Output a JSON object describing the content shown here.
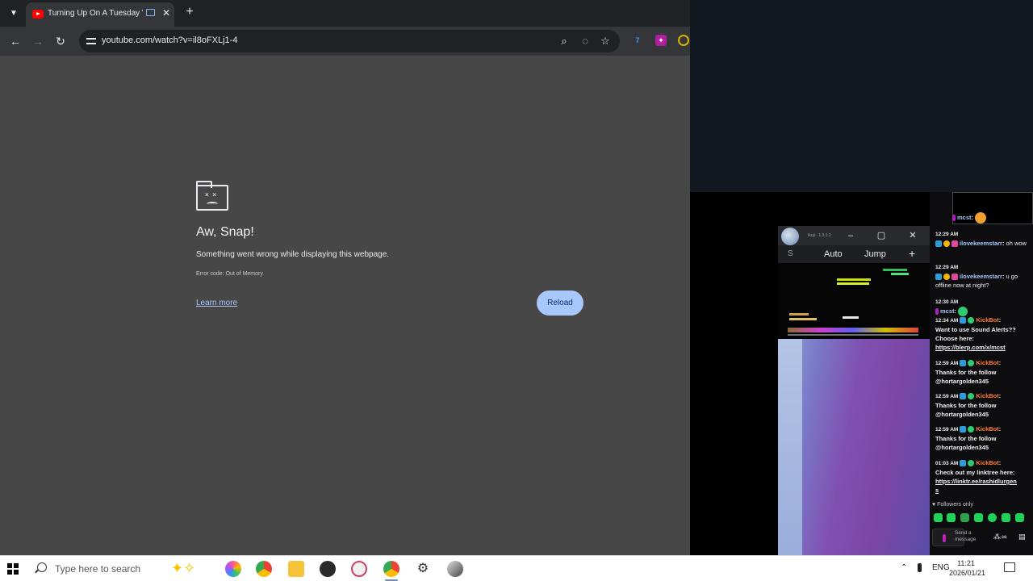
{
  "browser": {
    "tab": {
      "title": "Turning Up On A Tuesday V",
      "close": "✕"
    },
    "new_tab": "+",
    "url": "youtube.com/watch?v=il8oFXLj1-4"
  },
  "error_page": {
    "title": "Aw, Snap!",
    "description": "Something went wrong while displaying this webpage.",
    "error_code": "Error code: Out of Memory",
    "learn_more": "Learn more",
    "reload": "Reload"
  },
  "mini_player": {
    "title": "Ikuji · 1.3.1.2",
    "side_label": "S",
    "auto": "Auto",
    "jump": "Jump",
    "plus": "+"
  },
  "chat": {
    "top_user": "mcst",
    "messages": [
      {
        "time": "12:29 AM",
        "user": "ilovekeemstarr",
        "text": "oh wow",
        "user_color": "blue"
      },
      {
        "time": "12:29 AM",
        "user": "ilovekeemstarr",
        "text": "u go offline now at night?",
        "user_color": "blue"
      },
      {
        "time": "12:30 AM",
        "user": "mcst",
        "text": "",
        "user_color": "blue"
      },
      {
        "time": "12:34 AM",
        "user": "KickBot",
        "text": "Want to use Sound Alerts?? Choose here:",
        "link": "https://blerp.com/x/mcst",
        "user_color": "orange"
      },
      {
        "time": "12:59 AM",
        "user": "KickBot",
        "text": "Thanks for the follow @hortargolden345",
        "user_color": "orange"
      },
      {
        "time": "12:59 AM",
        "user": "KickBot",
        "text": "Thanks for the follow @hortargolden345",
        "user_color": "orange"
      },
      {
        "time": "12:59 AM",
        "user": "KickBot",
        "text": "Thanks for the follow @hortargolden345",
        "user_color": "orange"
      },
      {
        "time": "01:03 AM",
        "user": "KickBot",
        "text": "Check out my linktree here:",
        "link": "https://linktr.ee/rashidlurgen",
        "link_tail": "s",
        "user_color": "orange"
      }
    ],
    "followers_only": "Followers only",
    "send_placeholder": "Send a message"
  },
  "taskbar": {
    "search_placeholder": "Type here to search",
    "lang": "ENG",
    "time": "11:21",
    "date": "2026/01/21"
  },
  "colors": {
    "page_bg": "#474747",
    "reload_bg": "#a8c7fa",
    "kickbot": "#ff7a2e",
    "chat_user": "#a8c7ff"
  }
}
